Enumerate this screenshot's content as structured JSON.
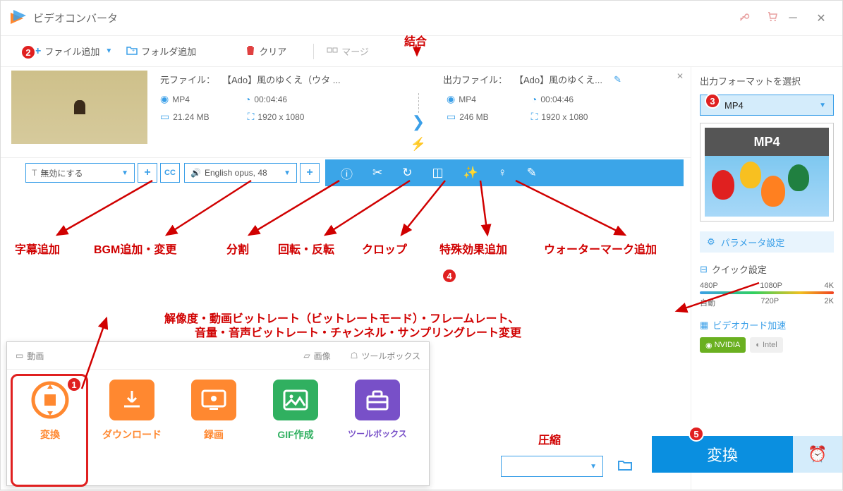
{
  "title": "ビデオコンバータ",
  "toolbar": {
    "add_file": "ファイル追加",
    "add_folder": "フォルダ追加",
    "clear": "クリア",
    "merge": "マージ"
  },
  "file": {
    "src_label": "元ファイル：",
    "src_name": "【Ado】風のゆくえ（ウタ ...",
    "dst_label": "出力ファイル：",
    "dst_name": "【Ado】風のゆくえ...",
    "src_format": "MP4",
    "src_duration": "00:04:46",
    "src_size": "21.24 MB",
    "src_resolution": "1920 x 1080",
    "dst_format": "MP4",
    "dst_duration": "00:04:46",
    "dst_size": "246 MB",
    "dst_resolution": "1920 x 1080"
  },
  "subtitle": {
    "current": "無効にする"
  },
  "audio": {
    "current": "English opus, 48"
  },
  "right": {
    "title": "出力フォーマットを選択",
    "format": "MP4",
    "preview_label": "MP4",
    "param_btn": "パラメータ設定",
    "quick_title": "クイック設定",
    "slider_top": [
      "480P",
      "1080P",
      "4K"
    ],
    "slider_bottom": [
      "自動",
      "720P",
      "2K"
    ],
    "gpu_title": "ビデオカード加速",
    "nvidia": "NVIDIA",
    "intel": "Intel"
  },
  "bottom": {
    "convert": "変換",
    "tabs": {
      "video": "動画",
      "image": "画像",
      "toolbox": "ツールボックス"
    },
    "modes": {
      "convert": "変換",
      "download": "ダウンロード",
      "record": "録画",
      "gif": "GIF作成",
      "toolbox": "ツールボックス"
    }
  },
  "annot": {
    "combine": "結合",
    "subtitle": "字幕追加",
    "bgm": "BGM追加・変更",
    "split": "分割",
    "rotate": "回転・反転",
    "crop": "クロップ",
    "effect": "特殊効果追加",
    "watermark": "ウォーターマーク追加",
    "params1": "解像度・動画ビットレート（ビットレートモード）・フレームレート、",
    "params2": "音量・音声ビットレート・チャンネル・サンプリングレート変更",
    "compress": "圧縮"
  },
  "badges": {
    "b1": "1",
    "b2": "2",
    "b3": "3",
    "b4": "4",
    "b5": "5"
  }
}
